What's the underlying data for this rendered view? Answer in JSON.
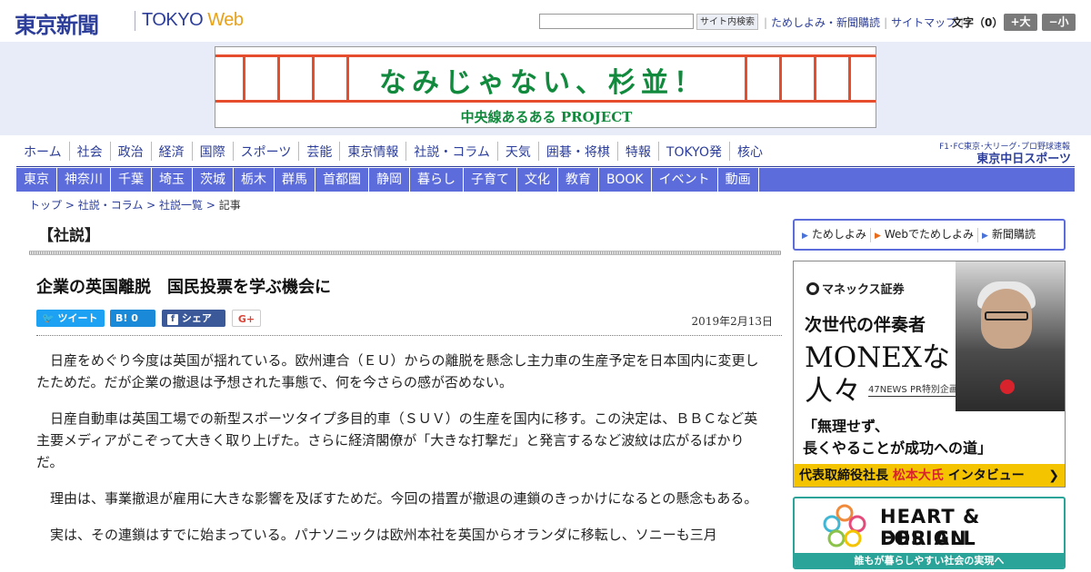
{
  "header": {
    "logo_jp": "東京新聞",
    "logo_en_main": "TOKYO ",
    "logo_en_web": "Web",
    "search_button": "サイト内検索",
    "links": [
      "ためしよみ・新聞購読",
      "サイトマップ"
    ],
    "font_size_label": "文字（0）",
    "font_up": "+大",
    "font_down": "−小"
  },
  "banner": {
    "title": "なみじゃない、杉並！",
    "subtitle": "中央線あるある PROJECT",
    "rail_color": "#e64d2d",
    "text_color": "#118a3d"
  },
  "nav": {
    "primary": [
      "ホーム",
      "社会",
      "政治",
      "経済",
      "国際",
      "スポーツ",
      "芸能",
      "東京情報",
      "社説・コラム",
      "天気",
      "囲碁・将棋",
      "特報",
      "TOKYO発",
      "核心"
    ],
    "secondary": [
      "東京",
      "神奈川",
      "千葉",
      "埼玉",
      "茨城",
      "栃木",
      "群馬",
      "首都圏",
      "静岡",
      "暮らし",
      "子育て",
      "文化",
      "教育",
      "BOOK",
      "イベント",
      "動画"
    ],
    "chunichi_top": "F1･FC東京･大リーグ･プロ野球速報",
    "chunichi_logo": "東京中日スポーツ"
  },
  "breadcrumb": {
    "items": [
      "トップ",
      "社説・コラム",
      "社説一覧"
    ],
    "current": "記事"
  },
  "article": {
    "section": "【社説】",
    "headline": "企業の英国離脱　国民投票を学ぶ機会に",
    "share": {
      "tweet": "ツイート",
      "hatena": "B! 0",
      "facebook": "シェア 0",
      "gplus": "G+"
    },
    "date": "2019年2月13日",
    "paragraphs": [
      "日産をめぐり今度は英国が揺れている。欧州連合（ＥＵ）からの離脱を懸念し主力車の生産予定を日本国内に変更したためだ。だが企業の撤退は予想された事態で、何を今さらの感が否めない。",
      "日産自動車は英国工場での新型スポーツタイプ多目的車（ＳＵＶ）の生産を国内に移す。この決定は、ＢＢＣなど英主要メディアがこぞって大きく取り上げた。さらに経済閣僚が「大きな打撃だ」と発言するなど波紋は広がるばかりだ。",
      "理由は、事業撤退が雇用に大きな影響を及ぼすためだ。今回の措置が撤退の連鎖のきっかけになるとの懸念もある。",
      "実は、その連鎖はすでに始まっている。パナソニックは欧州本社を英国からオランダに移転し、ソニーも三月"
    ]
  },
  "sidebar": {
    "subscribe_links": [
      "ためしよみ",
      "Webでためしよみ",
      "新聞購読"
    ],
    "ad1": {
      "brand": "マネックス証券",
      "line1": "次世代の伴奏者",
      "line2": "MONEXな",
      "line3": "人々",
      "tag": "47NEWS PR特別企画",
      "quote1": "「無理せず、",
      "quote2": "長くやることが成功への道」",
      "bar_prefix": "代表取締役社長 ",
      "bar_name": "松本大氏",
      "bar_suffix": " インタビュー",
      "bar_color": "#f4c400"
    },
    "ad2": {
      "line1": "HEART & DESIGN",
      "line2": "FOR ALL",
      "bar": "誰もが暮らしやすい社会の実現へ",
      "color": "#2aa398"
    }
  },
  "colors": {
    "brand_blue": "#2c3e9a",
    "nav_band": "#5c6ddb",
    "banner_bg": "#e8ecf8"
  }
}
